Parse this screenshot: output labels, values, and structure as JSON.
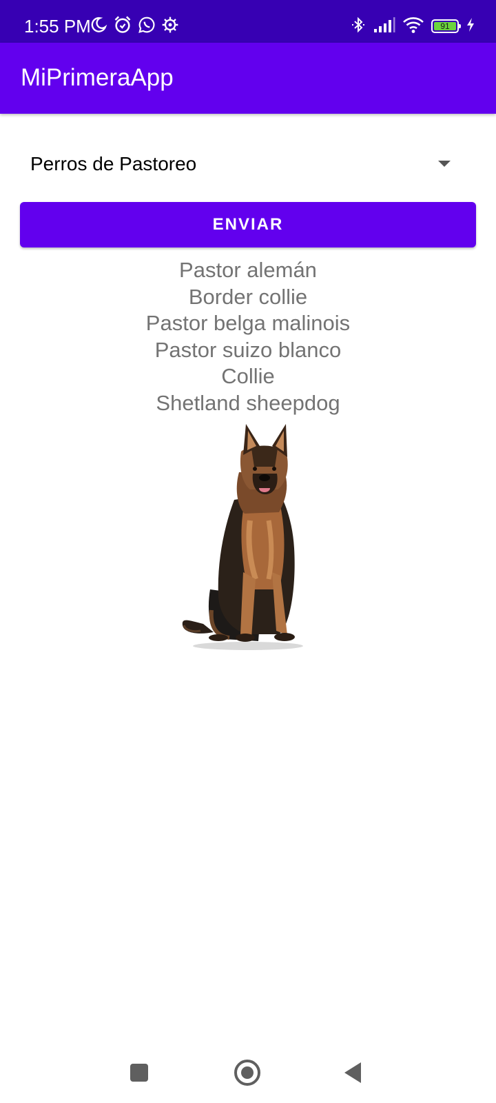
{
  "status_bar": {
    "time": "1:55 PM",
    "left_icons": [
      "moon-icon",
      "alarm-icon",
      "whatsapp-icon",
      "settings-gear-icon"
    ],
    "right_icons": [
      "bluetooth-icon",
      "signal-icon",
      "wifi-icon",
      "battery-icon",
      "charging-bolt-icon"
    ],
    "battery_level": "91"
  },
  "app_bar": {
    "title": "MiPrimeraApp"
  },
  "spinner": {
    "selected": "Perros de Pastoreo"
  },
  "send_button": {
    "label": "ENVIAR"
  },
  "results": [
    "Pastor alemán",
    "Border collie",
    "Pastor belga malinois",
    "Pastor suizo blanco",
    "Collie",
    "Shetland sheepdog"
  ],
  "nav_bar": {
    "buttons": [
      "recents-icon",
      "home-icon",
      "back-icon"
    ]
  },
  "colors": {
    "status_bar": "#3700b3",
    "primary": "#6200ee",
    "result_text": "#737373",
    "battery_fill": "#6bd43c"
  }
}
